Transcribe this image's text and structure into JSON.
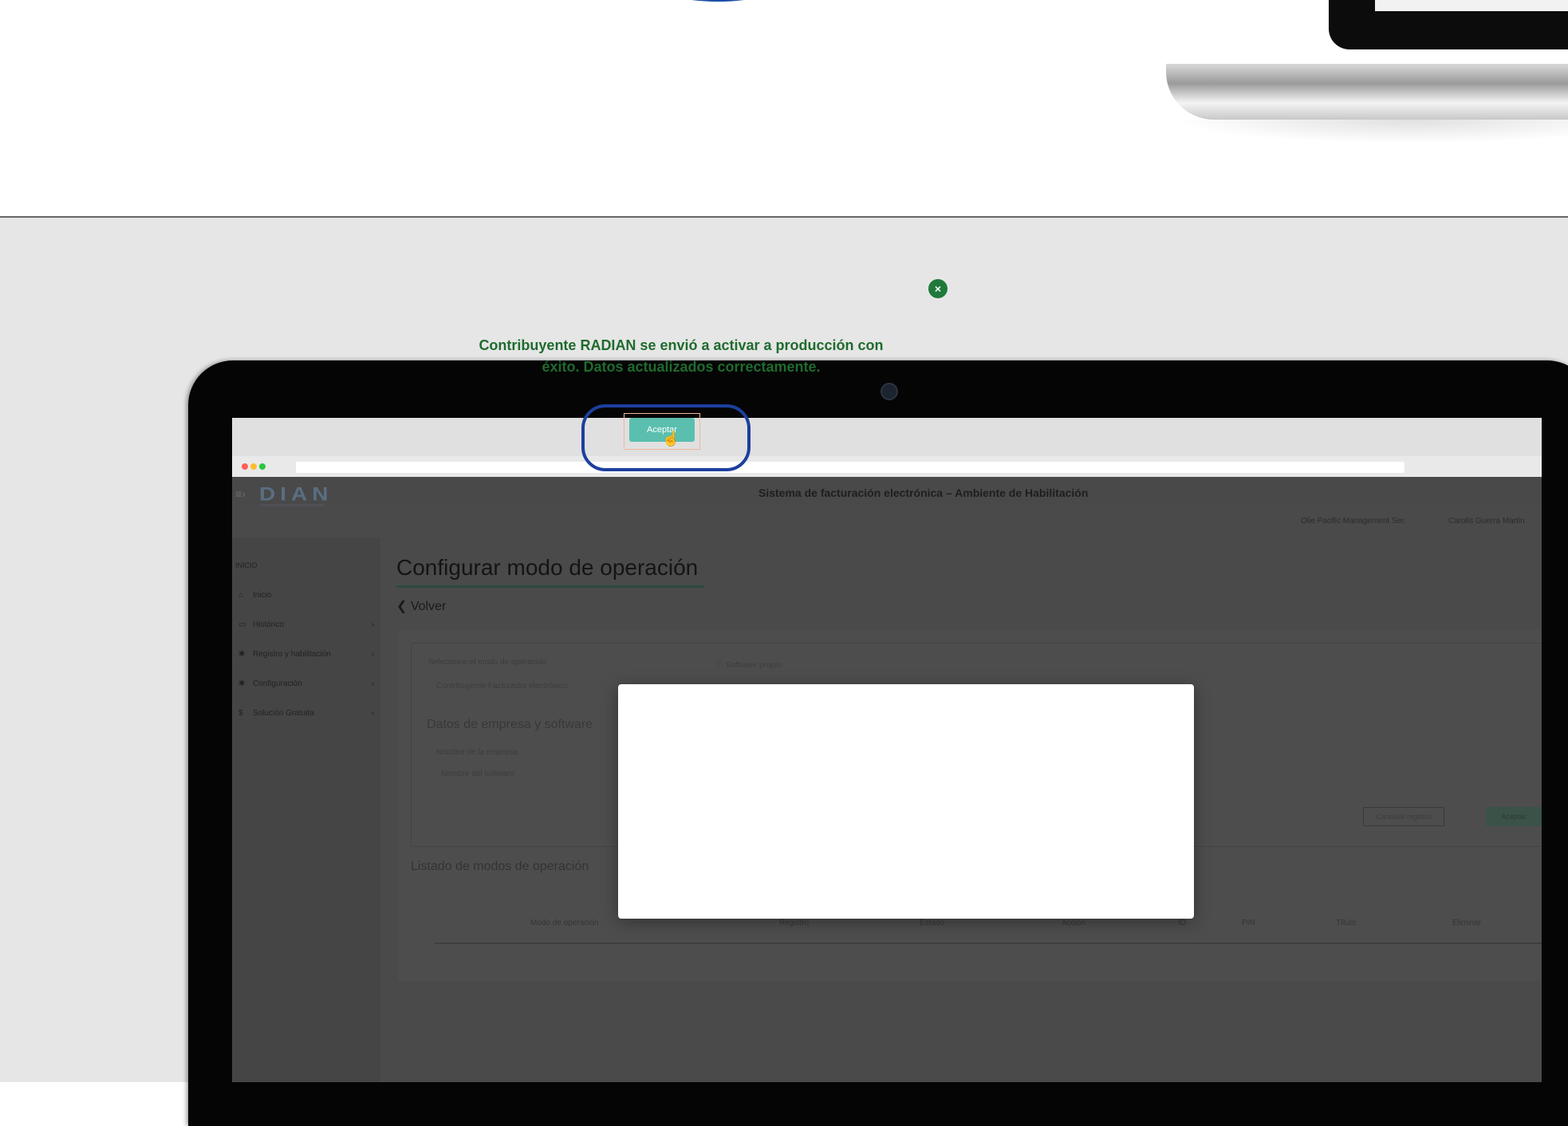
{
  "browser": {
    "traffic_lights": [
      "red",
      "yellow",
      "green"
    ]
  },
  "app": {
    "header_title": "Sistema de facturación electrónica – Ambiente de Habilitación",
    "header_company": "Olie Pacific Management Ser.",
    "header_user": "Carolis Guerra Martin",
    "sidebar": {
      "section": "INICIO",
      "items": [
        {
          "label": "Inicio",
          "icon": "home-icon",
          "glyph": "⌂",
          "arrow": ""
        },
        {
          "label": "Histórico",
          "icon": "history-icon",
          "glyph": "▭",
          "arrow": "›"
        },
        {
          "label": "Registro y habilitación",
          "icon": "gear-icon",
          "glyph": "✱",
          "arrow": "›"
        },
        {
          "label": "Configuración",
          "icon": "settings-icon",
          "glyph": "✱",
          "arrow": "›"
        },
        {
          "label": "Solución Gratuita",
          "icon": "dollar-icon",
          "glyph": "$",
          "arrow": "›"
        }
      ]
    },
    "page_title": "Configurar modo de operación",
    "back_label": "❮ Volver",
    "card": {
      "field1": "Seleccione el modo de operación",
      "field2": "ⓘ Software propio",
      "field3": "Contribuyente Facturador electrónico",
      "subtitle": "Datos de empresa y software",
      "field4": "Nombre de la empresa",
      "field5": "Nombre del software",
      "btn_cancel": "Cancelar registro",
      "btn_save": "Aceptar"
    },
    "list_title": "Listado de modos de operación",
    "table_headers": [
      "Modo de operación",
      "Registro",
      "Estado",
      "Acción",
      "ID",
      "PIN",
      "Título",
      "Eliminar"
    ]
  },
  "modal": {
    "close_glyph": "×",
    "message": "Contribuyente RADIAN se envió a activar a producción con éxito. Datos actualizados correctamente.",
    "accept_label": "Aceptar",
    "cursor_glyph": "☝"
  },
  "colors": {
    "accent_green": "#1f7a3a",
    "button_teal": "#5abfae",
    "callout_blue": "#1c3f9e",
    "overlay_grey": "#4a4a4a"
  }
}
